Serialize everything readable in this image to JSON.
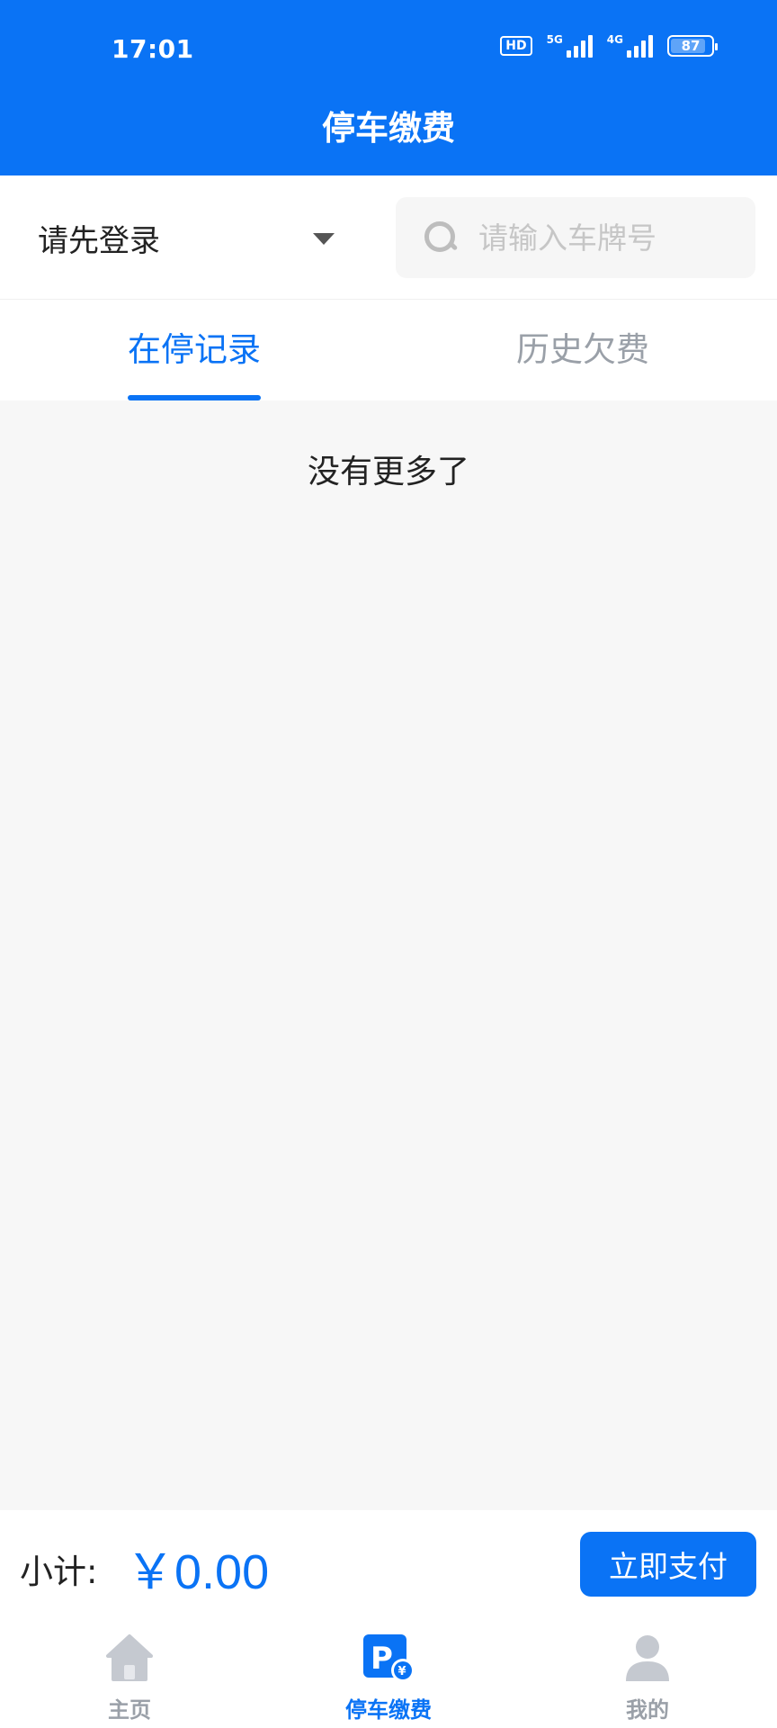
{
  "status_bar": {
    "time": "17:01",
    "hd_label": "HD",
    "net1_label": "5G",
    "net2_label": "4G",
    "battery_level": "87",
    "battery_fraction": 0.87
  },
  "header": {
    "title": "停车缴费"
  },
  "filter": {
    "login_label": "请先登录",
    "search_placeholder": "请输入车牌号",
    "search_value": ""
  },
  "tabs": [
    {
      "label": "在停记录",
      "active": true
    },
    {
      "label": "历史欠费",
      "active": false
    }
  ],
  "content": {
    "empty_text": "没有更多了"
  },
  "pay_bar": {
    "subtotal_label": "小计:",
    "amount": "￥0.00",
    "pay_button_label": "立即支付"
  },
  "bottom_nav": {
    "items": [
      {
        "label": "主页",
        "icon": "home-icon",
        "active": false
      },
      {
        "label": "停车缴费",
        "icon": "parking-pay-icon",
        "active": true
      },
      {
        "label": "我的",
        "icon": "user-icon",
        "active": false
      }
    ]
  },
  "colors": {
    "primary": "#0a73f5",
    "inactive": "#9aa0a8",
    "background": "#f7f7f7",
    "icon_gray": "#c5c9d0"
  }
}
